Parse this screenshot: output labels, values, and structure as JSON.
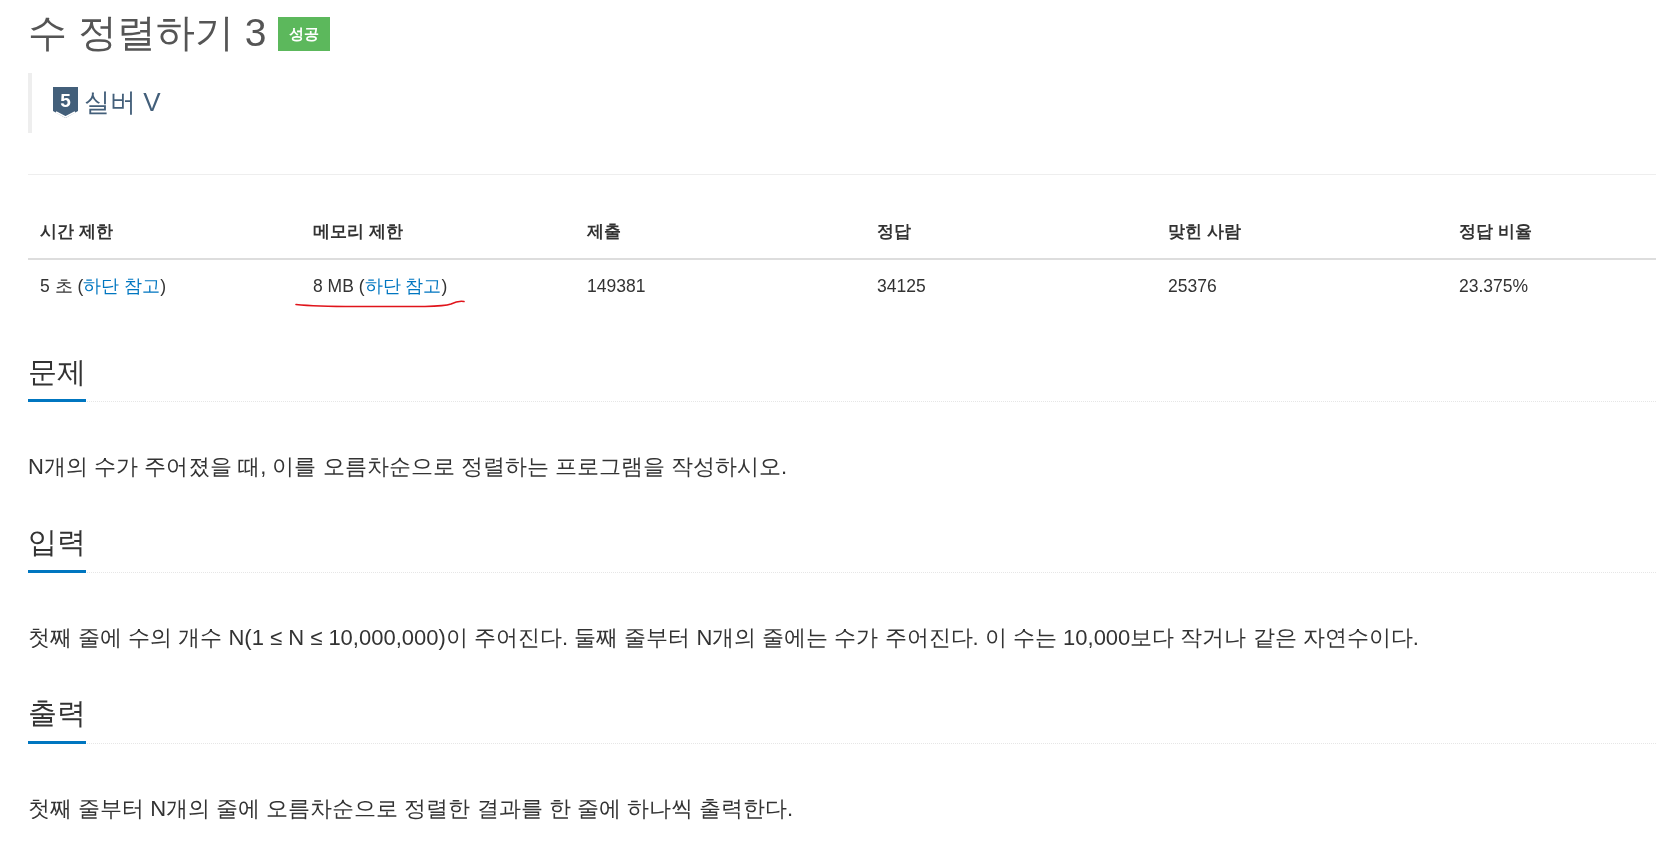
{
  "problem": {
    "title": "수 정렬하기 3",
    "result_badge": "성공"
  },
  "tier": {
    "badge": "5",
    "name": "실버 V"
  },
  "table": {
    "columns": [
      "시간 제한",
      "메모리 제한",
      "제출",
      "정답",
      "맞힌 사람",
      "정답 비율"
    ],
    "rows": [
      [
        {
          "parts": [
            {
              "kind": "text",
              "text": "5 초 ("
            },
            {
              "kind": "link",
              "text": "하단 참고"
            },
            {
              "kind": "text",
              "text": ")"
            }
          ],
          "marked": false
        },
        {
          "parts": [
            {
              "kind": "text",
              "text": "8 MB ("
            },
            {
              "kind": "link",
              "text": "하단 참고"
            },
            {
              "kind": "text",
              "text": ")"
            }
          ],
          "marked": true
        },
        {
          "text": "149381",
          "marked": false
        },
        {
          "text": "34125",
          "marked": false
        },
        {
          "text": "25376",
          "marked": false
        },
        {
          "text": "23.375%",
          "marked": false
        }
      ]
    ]
  },
  "sections": [
    {
      "heading": "문제",
      "text": "N개의 수가 주어졌을 때, 이를 오름차순으로 정렬하는 프로그램을 작성하시오."
    },
    {
      "heading": "입력",
      "text": "첫째 줄에 수의 개수 N(1 ≤ N ≤ 10,000,000)이 주어진다. 둘째 줄부터 N개의 줄에는 수가 주어진다. 이 수는 10,000보다 작거나 같은 자연수이다."
    },
    {
      "heading": "출력",
      "text": "첫째 줄부터 N개의 줄에 오름차순으로 정렬한 결과를 한 줄에 하나씩 출력한다."
    }
  ]
}
